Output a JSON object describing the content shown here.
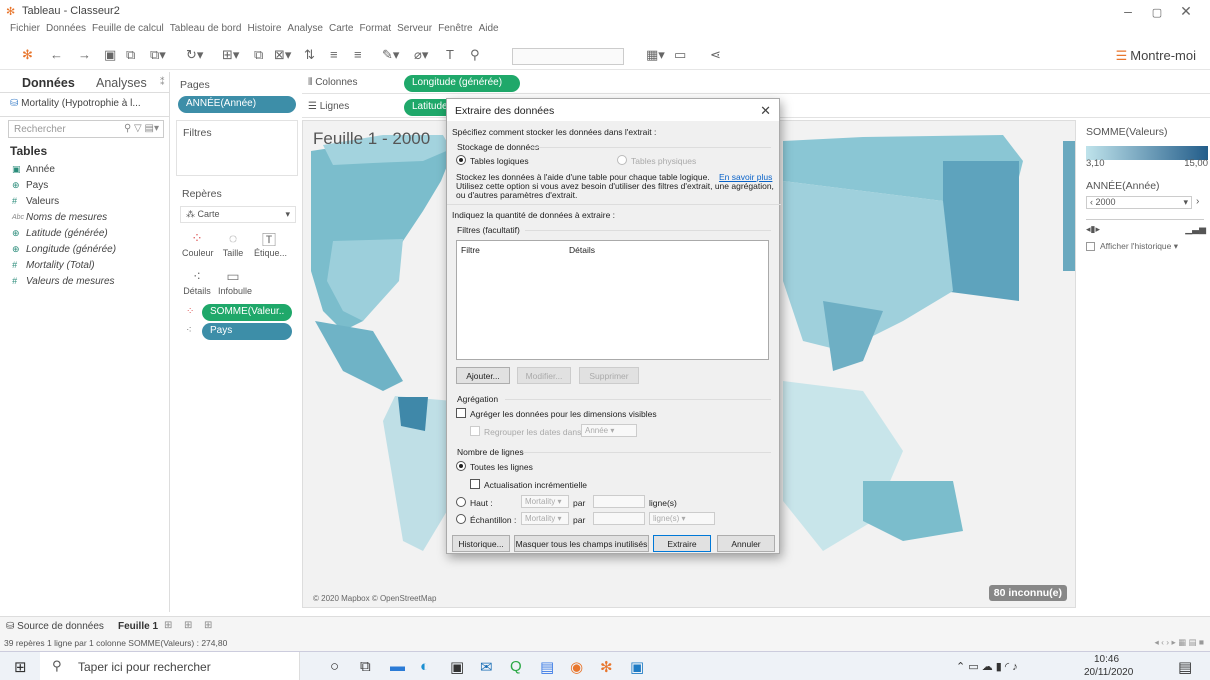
{
  "window": {
    "title": "Tableau - Classeur2"
  },
  "menu": [
    "Fichier",
    "Données",
    "Feuille de calcul",
    "Tableau de bord",
    "Histoire",
    "Analyse",
    "Carte",
    "Format",
    "Serveur",
    "Fenêtre",
    "Aide"
  ],
  "toolbar": {
    "show_me": "Montre-moi"
  },
  "left_pane": {
    "tabs": [
      "Données",
      "Analyses"
    ],
    "datasource": "Mortality (Hypotrophie à l...",
    "search_placeholder": "Rechercher",
    "tables_heading": "Tables",
    "fields": [
      {
        "label": "Année",
        "icon": "calendar-icon",
        "italic": false
      },
      {
        "label": "Pays",
        "icon": "globe-icon",
        "italic": false
      },
      {
        "label": "Valeurs",
        "icon": "measure-icon",
        "italic": false
      },
      {
        "label": "Noms de mesures",
        "icon": "abc-icon",
        "italic": true
      },
      {
        "label": "Latitude (générée)",
        "icon": "globe-icon",
        "italic": true
      },
      {
        "label": "Longitude (générée)",
        "icon": "globe-icon",
        "italic": true
      },
      {
        "label": "Mortality (Total)",
        "icon": "measure-icon",
        "italic": true
      },
      {
        "label": "Valeurs de mesures",
        "icon": "measure-icon",
        "italic": true
      }
    ]
  },
  "cards": {
    "pages_title": "Pages",
    "pages_pill": "ANNÉE(Année)",
    "filters_title": "Filtres",
    "marks_title": "Repères",
    "marks_type": "Carte",
    "mark_buttons": [
      "Couleur",
      "Taille",
      "Étique...",
      "Détails",
      "Infobulle"
    ],
    "mark_pills": [
      "SOMME(Valeur..",
      "Pays"
    ]
  },
  "shelves": {
    "columns_label": "Colonnes",
    "columns_pill": "Longitude (générée)",
    "rows_label": "Lignes",
    "rows_pill": "Latitude (générée)"
  },
  "view": {
    "sheet_title": "Feuille 1 - 2000",
    "copyright": "© 2020 Mapbox © OpenStreetMap",
    "unknown_badge": "80 inconnu(e)"
  },
  "legend": {
    "title": "SOMME(Valeurs)",
    "min": "3,10",
    "max": "15,00",
    "page_title": "ANNÉE(Année)",
    "page_value": "2000",
    "show_history": "Afficher l'historique ▾",
    "colors": {
      "low": "#bfe3eb",
      "high": "#235d8a"
    }
  },
  "dialog": {
    "title": "Extraire des données",
    "intro": "Spécifiez comment stocker les données dans l'extrait :",
    "storage_group": "Stockage de données",
    "opt_logical": "Tables logiques",
    "opt_physical": "Tables physiques",
    "desc1": "Stockez les données à l'aide d'une table pour chaque table logique.",
    "desc_link": "En savoir plus",
    "desc2": "Utilisez cette option si vous avez besoin d'utiliser des filtres d'extrait, une agrégation,",
    "desc3": "ou d'autres paramètres d'extrait.",
    "quantity": "Indiquez la quantité de données à extraire :",
    "filters_group": "Filtres (facultatif)",
    "col_filter": "Filtre",
    "col_details": "Détails",
    "btn_add": "Ajouter...",
    "btn_modify": "Modifier...",
    "btn_delete": "Supprimer",
    "agg_group": "Agrégation",
    "agg_check": "Agréger les données pour les dimensions visibles",
    "rollup_check": "Regrouper les dates dans",
    "rollup_select": "Année",
    "rows_group": "Nombre de lignes",
    "opt_all": "Toutes les lignes",
    "incremental": "Actualisation incrémentielle",
    "opt_top": "Haut :",
    "top_field": "Mortality",
    "by": "par",
    "rows_unit": "ligne(s)",
    "opt_sample": "Échantillon :",
    "sample_field": "Mortality",
    "sample_unit": "ligne(s)",
    "btn_history": "Historique...",
    "btn_hide": "Masquer tous les champs inutilisés",
    "btn_extract": "Extraire",
    "btn_cancel": "Annuler"
  },
  "sheet_tabs": {
    "datasource": "Source de données",
    "sheet1": "Feuille 1"
  },
  "status": {
    "text": "39 repères   1 ligne par 1 colonne   SOMME(Valeurs) : 274,80"
  },
  "taskbar": {
    "search": "Taper ici pour rechercher",
    "time": "10:46",
    "date": "20/11/2020"
  }
}
